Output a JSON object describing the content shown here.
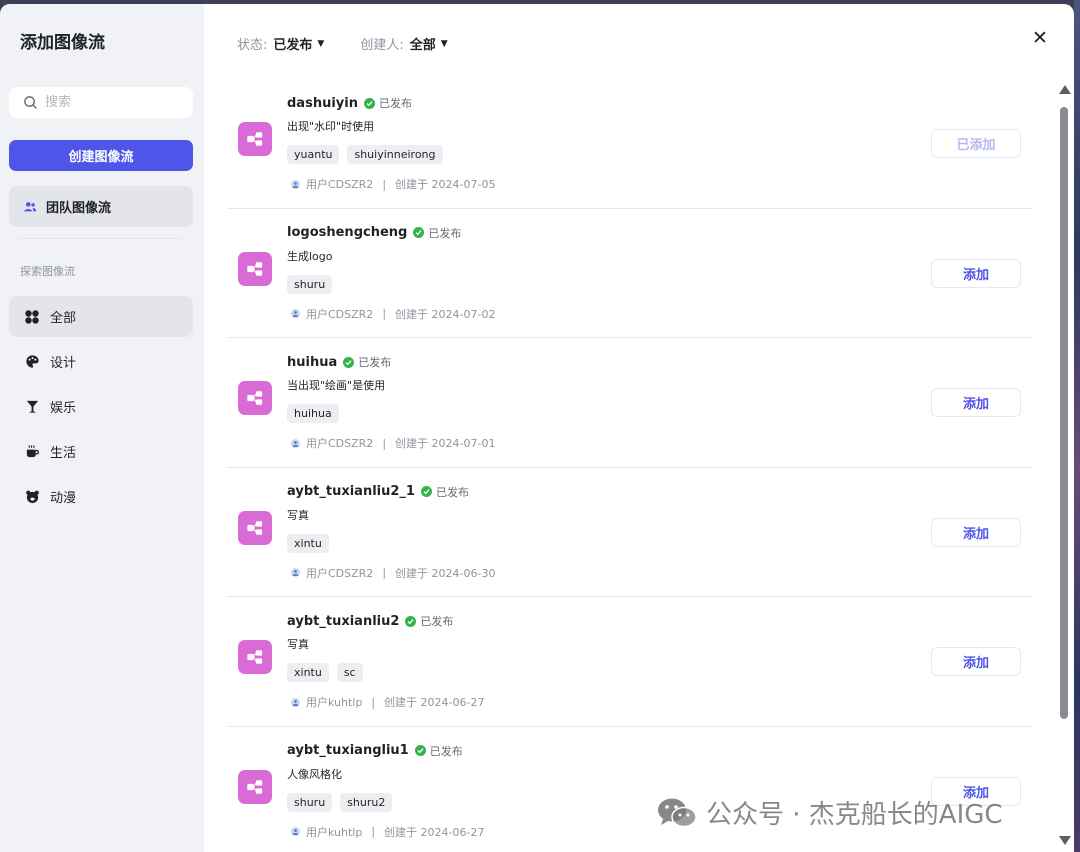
{
  "dialog": {
    "title": "添加图像流",
    "close_label": "✕"
  },
  "sidebar": {
    "search_placeholder": "搜索",
    "create_label": "创建图像流",
    "team_label": "团队图像流",
    "explore_label": "探索图像流",
    "categories": [
      {
        "label": "全部",
        "icon": "grid-icon",
        "active": true
      },
      {
        "label": "设计",
        "icon": "palette-icon",
        "active": false
      },
      {
        "label": "娱乐",
        "icon": "cocktail-icon",
        "active": false
      },
      {
        "label": "生活",
        "icon": "coffee-cup-icon",
        "active": false
      },
      {
        "label": "动漫",
        "icon": "bear-face-icon",
        "active": false
      }
    ]
  },
  "filters": {
    "status_label": "状态:",
    "status_value": "已发布",
    "creator_label": "创建人:",
    "creator_value": "全部"
  },
  "items": [
    {
      "name": "dashuiyin",
      "status": "已发布",
      "desc": "出现\"水印\"时使用",
      "tags": [
        "yuantu",
        "shuiyinneirong"
      ],
      "user": "用户CDSZR2",
      "created": "创建于 2024-07-05",
      "button": "已添加",
      "added": true
    },
    {
      "name": "logoshengcheng",
      "status": "已发布",
      "desc": "生成logo",
      "tags": [
        "shuru"
      ],
      "user": "用户CDSZR2",
      "created": "创建于 2024-07-02",
      "button": "添加",
      "added": false
    },
    {
      "name": "huihua",
      "status": "已发布",
      "desc": "当出现\"绘画\"是使用",
      "tags": [
        "huihua"
      ],
      "user": "用户CDSZR2",
      "created": "创建于 2024-07-01",
      "button": "添加",
      "added": false
    },
    {
      "name": "aybt_tuxianliu2_1",
      "status": "已发布",
      "desc": "写真",
      "tags": [
        "xintu"
      ],
      "user": "用户CDSZR2",
      "created": "创建于 2024-06-30",
      "button": "添加",
      "added": false
    },
    {
      "name": "aybt_tuxianliu2",
      "status": "已发布",
      "desc": "写真",
      "tags": [
        "xintu",
        "sc"
      ],
      "user": "用户kuhtlp",
      "created": "创建于 2024-06-27",
      "button": "添加",
      "added": false
    },
    {
      "name": "aybt_tuxiangliu1",
      "status": "已发布",
      "desc": "人像风格化",
      "tags": [
        "shuru",
        "shuru2"
      ],
      "user": "用户kuhtlp",
      "created": "创建于 2024-06-27",
      "button": "添加",
      "added": false
    }
  ],
  "meta_separator": "|",
  "watermark": "公众号 · 杰克船长的AIGC",
  "colors": {
    "accent": "#4f55e8",
    "flow_icon_bg": "#d96ad6",
    "published_green": "#34b34a",
    "sidebar_bg": "#f1f2f6"
  }
}
